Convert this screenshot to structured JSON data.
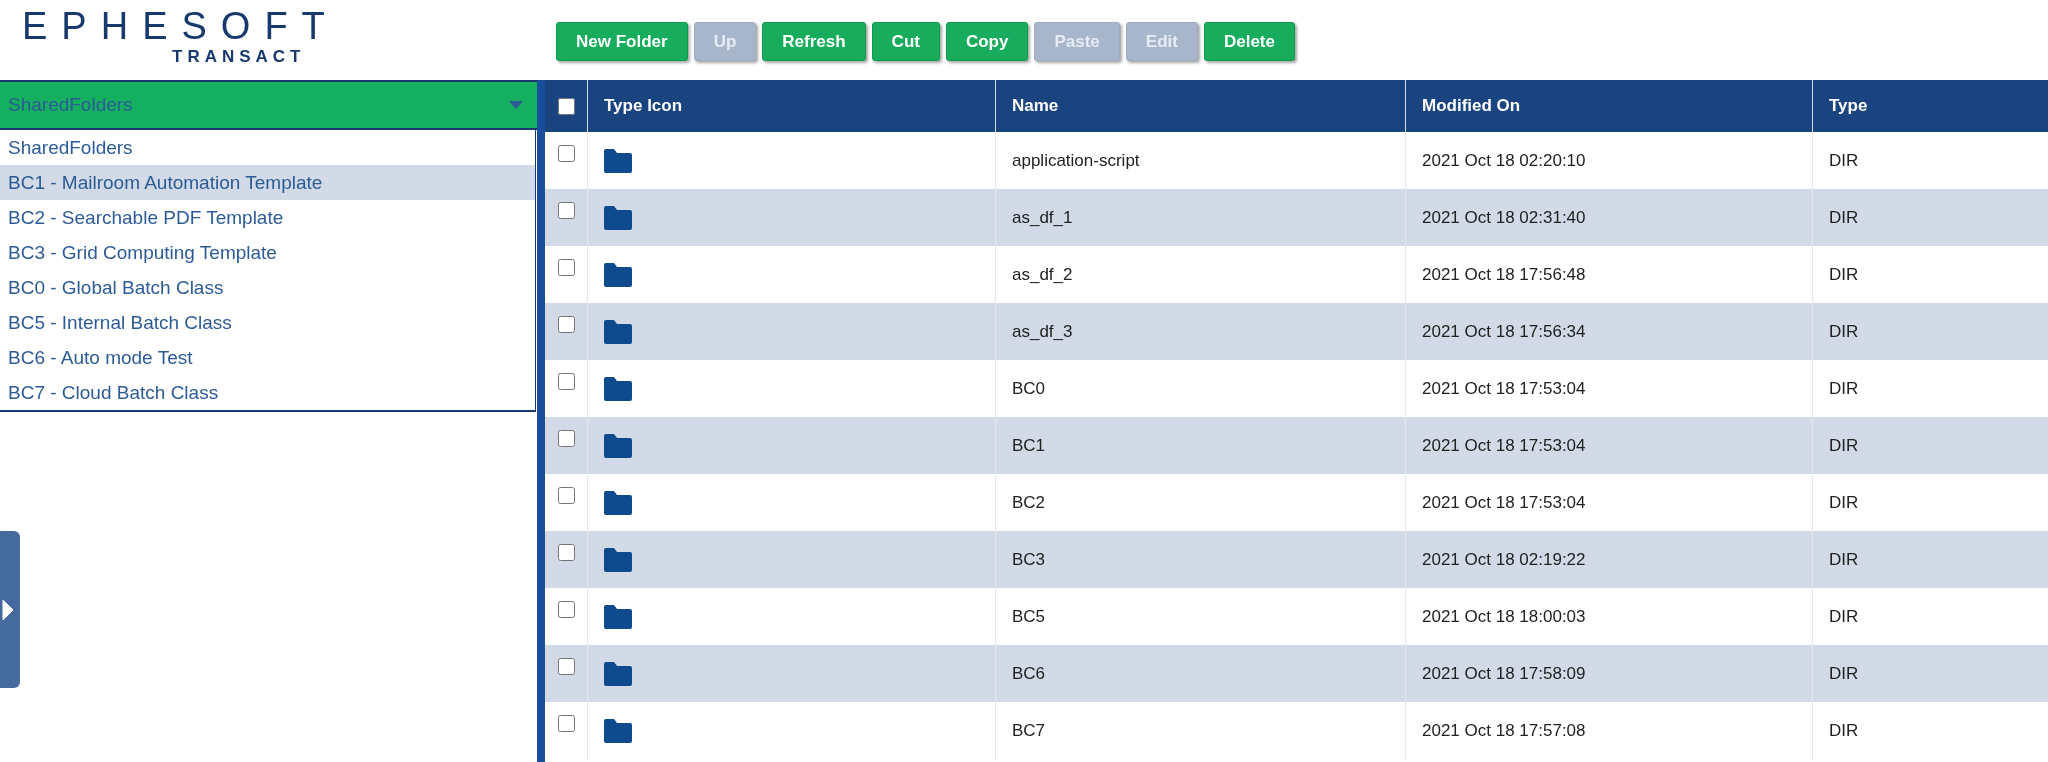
{
  "logo": {
    "brand": "EPHESOFT",
    "product": "TRANSACT"
  },
  "toolbar": [
    {
      "label": "New Folder",
      "disabled": false
    },
    {
      "label": "Up",
      "disabled": true
    },
    {
      "label": "Refresh",
      "disabled": false
    },
    {
      "label": "Cut",
      "disabled": false
    },
    {
      "label": "Copy",
      "disabled": false
    },
    {
      "label": "Paste",
      "disabled": true
    },
    {
      "label": "Edit",
      "disabled": true
    },
    {
      "label": "Delete",
      "disabled": false
    }
  ],
  "folder_select": {
    "value": "SharedFolders",
    "expanded": true,
    "options": [
      {
        "label": "SharedFolders",
        "highlighted": false
      },
      {
        "label": "BC1 - Mailroom Automation Template",
        "highlighted": true
      },
      {
        "label": "BC2 - Searchable PDF Template",
        "highlighted": false
      },
      {
        "label": "BC3 - Grid Computing Template",
        "highlighted": false
      },
      {
        "label": "BC0 - Global Batch Class",
        "highlighted": false
      },
      {
        "label": "BC5 - Internal Batch Class",
        "highlighted": false
      },
      {
        "label": "BC6 - Auto mode Test",
        "highlighted": false
      },
      {
        "label": "BC7 - Cloud Batch Class",
        "highlighted": false
      }
    ]
  },
  "table": {
    "select_all": {
      "checked": false
    },
    "columns": [
      "Type Icon",
      "Name",
      "Modified On",
      "Type"
    ],
    "rows": [
      {
        "checked": false,
        "name": "application-script",
        "modified": "2021 Oct 18 02:20:10",
        "type": "DIR"
      },
      {
        "checked": false,
        "name": "as_df_1",
        "modified": "2021 Oct 18 02:31:40",
        "type": "DIR"
      },
      {
        "checked": false,
        "name": "as_df_2",
        "modified": "2021 Oct 18 17:56:48",
        "type": "DIR"
      },
      {
        "checked": false,
        "name": "as_df_3",
        "modified": "2021 Oct 18 17:56:34",
        "type": "DIR"
      },
      {
        "checked": false,
        "name": "BC0",
        "modified": "2021 Oct 18 17:53:04",
        "type": "DIR"
      },
      {
        "checked": false,
        "name": "BC1",
        "modified": "2021 Oct 18 17:53:04",
        "type": "DIR"
      },
      {
        "checked": false,
        "name": "BC2",
        "modified": "2021 Oct 18 17:53:04",
        "type": "DIR"
      },
      {
        "checked": false,
        "name": "BC3",
        "modified": "2021 Oct 18 02:19:22",
        "type": "DIR"
      },
      {
        "checked": false,
        "name": "BC5",
        "modified": "2021 Oct 18 18:00:03",
        "type": "DIR"
      },
      {
        "checked": false,
        "name": "BC6",
        "modified": "2021 Oct 18 17:58:09",
        "type": "DIR"
      },
      {
        "checked": false,
        "name": "BC7",
        "modified": "2021 Oct 18 17:57:08",
        "type": "DIR"
      }
    ]
  }
}
